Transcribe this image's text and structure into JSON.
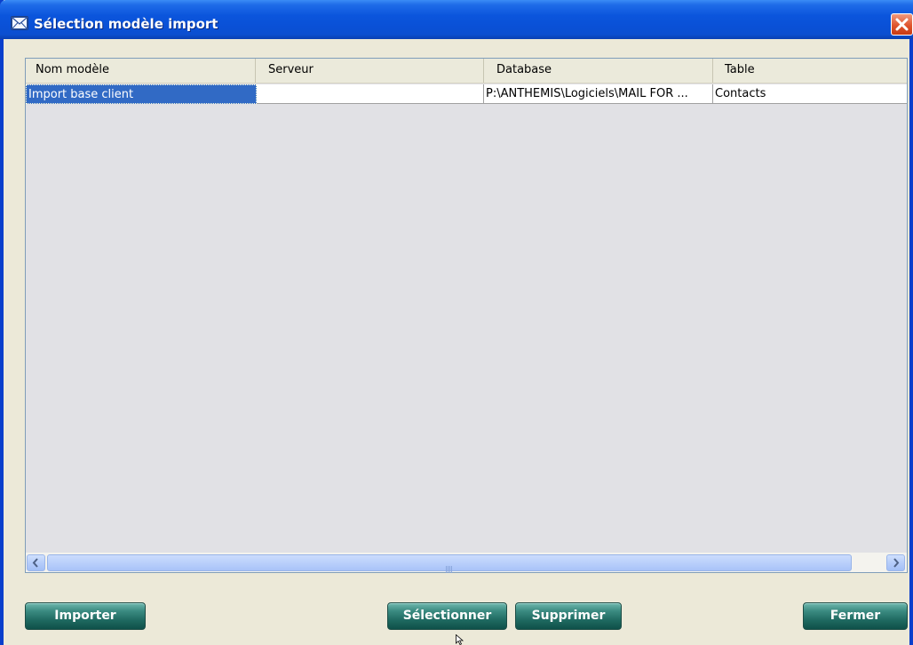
{
  "window": {
    "title": "Sélection modèle import",
    "title_icon": "mail-envelope-icon",
    "close_icon": "close-icon"
  },
  "grid": {
    "columns": [
      "Nom modèle",
      "Serveur",
      "Database",
      "Table"
    ],
    "rows": [
      {
        "nom_modele": "Import base client",
        "serveur": "",
        "database": "P:\\ANTHEMIS\\Logiciels\\MAIL FOR ...",
        "table": "Contacts",
        "selected": true
      }
    ],
    "scrollbar": {
      "left_icon": "scroll-left-icon",
      "right_icon": "scroll-right-icon"
    }
  },
  "buttons": {
    "importer": "Importer",
    "selectionner": "Sélectionner",
    "supprimer": "Supprimer",
    "fermer": "Fermer"
  },
  "colors": {
    "titlebar": "#0b55dc",
    "selection": "#316ac5",
    "button": "#1f6a61",
    "grid_background": "#e1e1e5",
    "close_button": "#e0552e"
  }
}
